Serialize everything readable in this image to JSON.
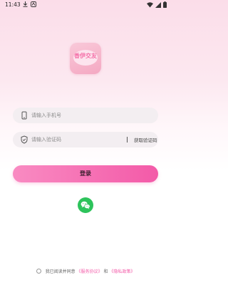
{
  "status_bar": {
    "time": "11:43",
    "icons": [
      "download-icon",
      "notification-app-icon",
      "wifi-icon",
      "signal-icon",
      "battery-icon"
    ]
  },
  "logo": {
    "text": "香伊交友"
  },
  "phone_field": {
    "placeholder": "请输入手机号",
    "value": "",
    "icon": "phone-icon"
  },
  "code_field": {
    "placeholder": "请输入验证码",
    "value": "",
    "icon": "shield-icon",
    "get_code_label": "获取验证码"
  },
  "login_button": {
    "label": "登录"
  },
  "wechat_login": {
    "icon": "wechat-icon"
  },
  "agreement": {
    "prefix": "我已阅读并同意",
    "terms_link": "《服务协议》",
    "and": "和",
    "privacy_link": "《隐私政策》"
  },
  "colors": {
    "accent": "#f35aa8",
    "wechat": "#2dc35b"
  }
}
